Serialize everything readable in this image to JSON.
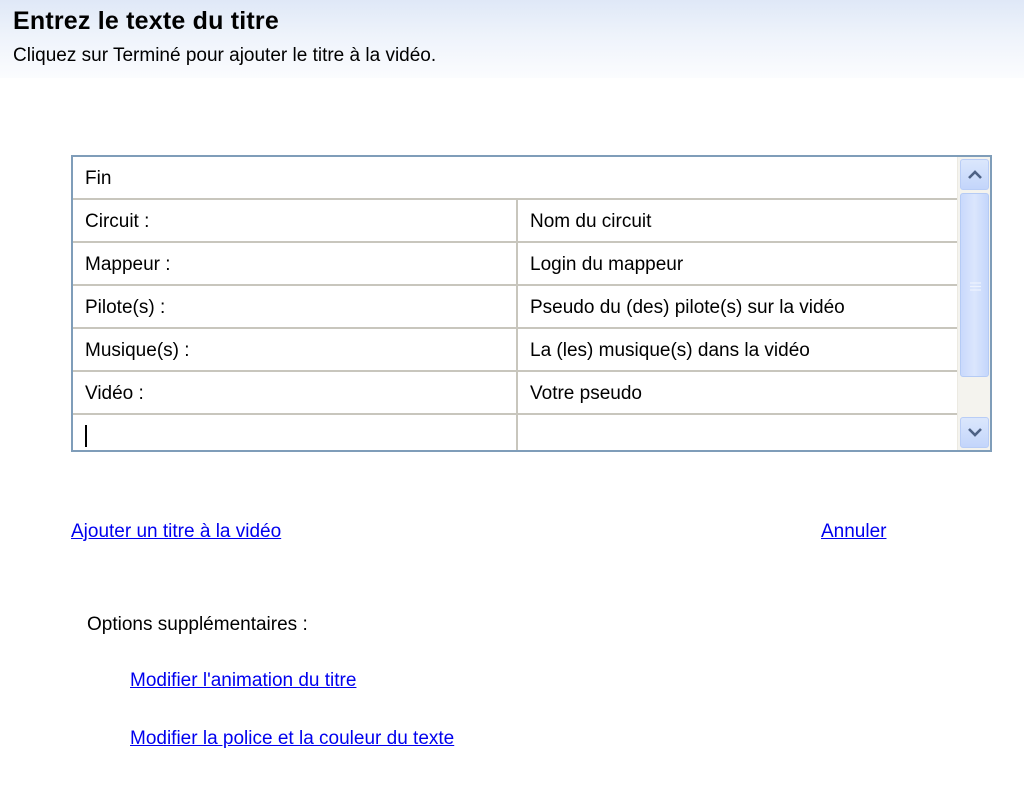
{
  "header": {
    "title": "Entrez le texte du titre",
    "subtitle": "Cliquez sur Terminé pour ajouter le titre à la vidéo."
  },
  "editor": {
    "first_line": "Fin",
    "rows": [
      {
        "left": "Circuit :",
        "right": "Nom du circuit"
      },
      {
        "left": "Mappeur :",
        "right": "Login du mappeur"
      },
      {
        "left": "Pilote(s) :",
        "right": "Pseudo du (des) pilote(s) sur la vidéo"
      },
      {
        "left": "Musique(s) :",
        "right": "La (les) musique(s) dans la vidéo"
      },
      {
        "left": "Vidéo :",
        "right": "Votre pseudo"
      },
      {
        "left": "",
        "right": ""
      }
    ]
  },
  "actions": {
    "add_title": "Ajouter un titre à la vidéo",
    "cancel": "Annuler"
  },
  "options": {
    "label": "Options supplémentaires :",
    "change_animation": "Modifier l'animation du titre",
    "change_font_color": "Modifier la police et la couleur du texte"
  },
  "colors": {
    "link": "#0000ee",
    "header_gradient_top": "#dfe8f7",
    "editor_border": "#7f9db9"
  },
  "icons": [
    "scroll-up-arrow-icon",
    "scroll-down-arrow-icon",
    "scroll-grip-icon"
  ]
}
